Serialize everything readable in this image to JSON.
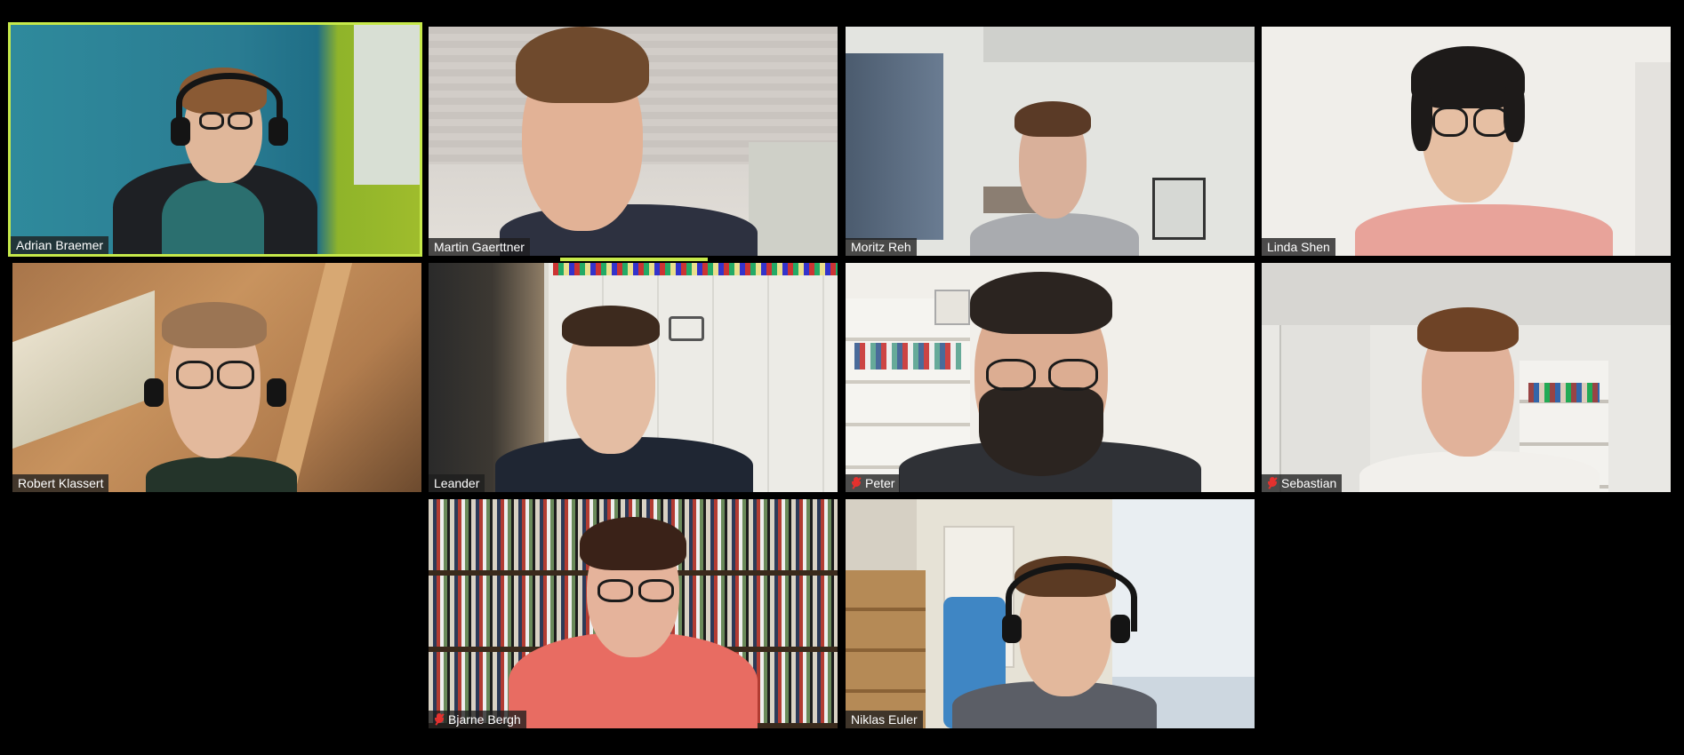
{
  "meeting": {
    "active_speaker": "Adrian Braemer",
    "accent_color": "#c6e94a",
    "mute_color": "#e5312e"
  },
  "participants": [
    {
      "name": "Adrian Braemer",
      "muted": false,
      "active": true
    },
    {
      "name": "Martin Gaerttner",
      "muted": false,
      "active": false
    },
    {
      "name": "Moritz Reh",
      "muted": false,
      "active": false
    },
    {
      "name": "Linda Shen",
      "muted": false,
      "active": false
    },
    {
      "name": "Robert Klassert",
      "muted": false,
      "active": false
    },
    {
      "name": "Leander",
      "muted": false,
      "active": false
    },
    {
      "name": "Peter",
      "muted": true,
      "active": false
    },
    {
      "name": "Sebastian",
      "muted": true,
      "active": false
    },
    {
      "name": "Bjarne Bergh",
      "muted": true,
      "active": false
    },
    {
      "name": "Niklas Euler",
      "muted": false,
      "active": false
    }
  ],
  "icons": {
    "muted": "mic-muted-icon"
  }
}
